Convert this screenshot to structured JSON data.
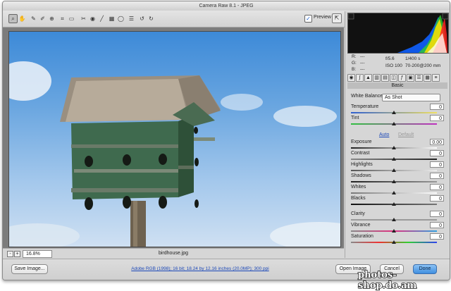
{
  "window": {
    "title": "Camera Raw 8.1  -  JPEG"
  },
  "toolbar": {
    "tools": [
      "zoom-icon",
      "hand-icon",
      "white-balance-icon",
      "color-sampler-icon",
      "targeted-adjustment-icon",
      "crop-icon",
      "straighten-icon",
      "spot-removal-icon",
      "red-eye-icon",
      "adjustment-brush-icon",
      "graduated-filter-icon",
      "radial-filter-icon",
      "preferences-icon",
      "rotate-ccw-icon",
      "rotate-cw-icon"
    ],
    "preview_label": "Preview",
    "preview_checked": true
  },
  "readout": {
    "r_label": "R:",
    "g_label": "G:",
    "b_label": "B:",
    "r": "---",
    "g": "---",
    "b": "---",
    "aperture": "f/5.6",
    "shutter": "1/400 s",
    "iso": "ISO 100",
    "lens": "70-200@200 mm"
  },
  "status": {
    "zoom_minus": "-",
    "zoom_plus": "+",
    "zoom": "16.8%",
    "filename": "birdhouse.jpg"
  },
  "panel": {
    "title": "Basic",
    "white_balance_label": "White Balance:",
    "white_balance_value": "As Shot",
    "auto": "Auto",
    "default": "Default",
    "sliders": [
      {
        "label": "Temperature",
        "value": "0",
        "pos": 0.5
      },
      {
        "label": "Tint",
        "value": "0",
        "pos": 0.5
      },
      {
        "label": "Exposure",
        "value": "0.00",
        "pos": 0.5
      },
      {
        "label": "Contrast",
        "value": "0",
        "pos": 0.5
      },
      {
        "label": "Highlights",
        "value": "0",
        "pos": 0.5
      },
      {
        "label": "Shadows",
        "value": "0",
        "pos": 0.5
      },
      {
        "label": "Whites",
        "value": "0",
        "pos": 0.5
      },
      {
        "label": "Blacks",
        "value": "0",
        "pos": 0.5
      },
      {
        "label": "Clarity",
        "value": "0",
        "pos": 0.5
      },
      {
        "label": "Vibrance",
        "value": "0",
        "pos": 0.5
      },
      {
        "label": "Saturation",
        "value": "0",
        "pos": 0.5
      }
    ]
  },
  "bottom": {
    "save": "Save Image...",
    "workflow": "Adobe RGB (1998); 16 bit; 18.24 by 12.16 inches (20.0MP); 300 ppi",
    "open": "Open Image",
    "cancel": "Cancel",
    "done": "Done"
  },
  "watermark": "photos-shop.do.am",
  "colors": {
    "accent": "#3f8fe0",
    "link": "#1a47b8"
  }
}
